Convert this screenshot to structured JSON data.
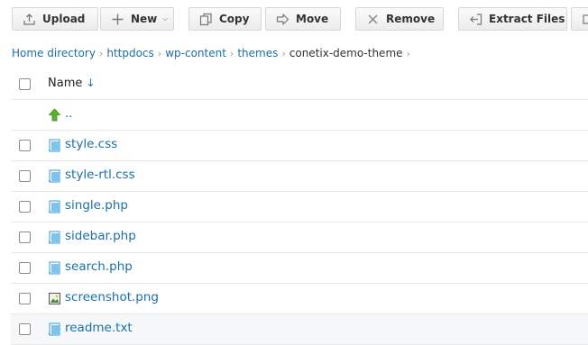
{
  "toolbar": {
    "upload_label": "Upload",
    "new_label": "New",
    "copy_label": "Copy",
    "move_label": "Move",
    "remove_label": "Remove",
    "extract_label": "Extract Files"
  },
  "breadcrumb": {
    "items": [
      "Home directory",
      "httpdocs",
      "wp-content",
      "themes",
      "conetix-demo-theme"
    ]
  },
  "table": {
    "header_name": "Name",
    "sort_indicator": "↓",
    "parent_label": "..",
    "files": [
      {
        "name": "style.css",
        "type": "file"
      },
      {
        "name": "style-rtl.css",
        "type": "file"
      },
      {
        "name": "single.php",
        "type": "file"
      },
      {
        "name": "sidebar.php",
        "type": "file"
      },
      {
        "name": "search.php",
        "type": "file"
      },
      {
        "name": "screenshot.png",
        "type": "image"
      },
      {
        "name": "readme.txt",
        "type": "file"
      }
    ]
  },
  "colors": {
    "link": "#1a6fa8",
    "file_icon": "#3a9ad9",
    "parent_icon": "#5cb22c",
    "image_icon": "#4a8a3a"
  },
  "icons": {
    "upload": "upload-icon",
    "new": "plus-icon",
    "copy": "copy-icon",
    "move": "arrow-right-icon",
    "remove": "x-icon",
    "extract": "extract-icon",
    "parent": "up-arrow-icon",
    "file": "file-icon",
    "image": "image-icon"
  }
}
